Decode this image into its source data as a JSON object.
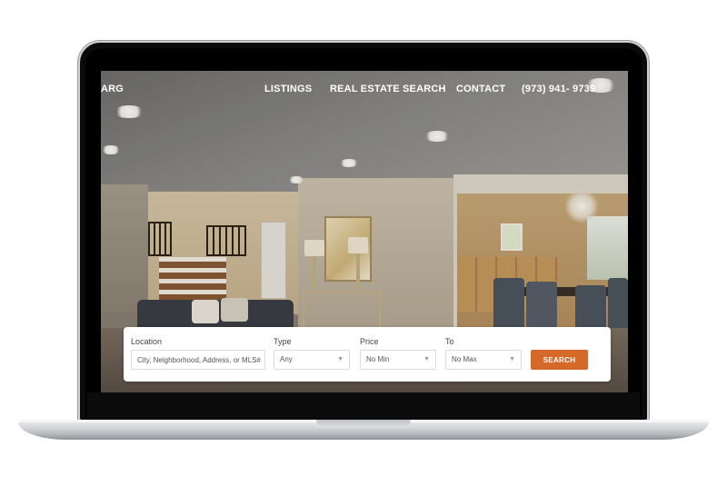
{
  "nav": {
    "brand": "ARG",
    "links": [
      {
        "label": "LISTINGS"
      },
      {
        "label": "REAL ESTATE SEARCH"
      },
      {
        "label": "CONTACT"
      },
      {
        "label": "(973) 941- 9739"
      }
    ]
  },
  "search": {
    "location": {
      "label": "Location",
      "placeholder": "City, Neighborhood, Address, or MLS#"
    },
    "type": {
      "label": "Type",
      "value": "Any"
    },
    "price_min": {
      "label": "Price",
      "value": "No Min"
    },
    "price_max": {
      "label": "To",
      "value": "No Max"
    },
    "button_label": "SEARCH"
  },
  "colors": {
    "accent": "#d4692a",
    "nav_text": "#ffffff",
    "panel_bg": "#ffffff"
  },
  "icons": {
    "dropdown": "chevron-down-icon"
  }
}
